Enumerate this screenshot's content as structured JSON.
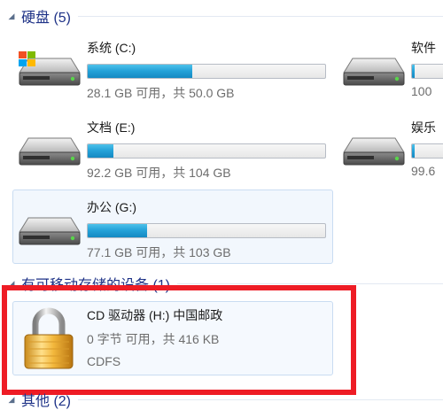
{
  "groups": {
    "hard_disks": {
      "title": "硬盘 (5)"
    },
    "removable": {
      "title": "有可移动存储的设备 (1)"
    },
    "other": {
      "title": "其他 (2)"
    }
  },
  "drives": [
    {
      "name": "系统 (C:)",
      "info": "28.1 GB 可用，共 50.0 GB",
      "used_fraction": 0.44
    },
    {
      "name": "软件",
      "info": "100",
      "used_fraction": 0.05
    },
    {
      "name": "文档 (E:)",
      "info": "92.2 GB 可用，共 104 GB",
      "used_fraction": 0.11
    },
    {
      "name": "娱乐",
      "info": "99.6",
      "used_fraction": 0.05
    },
    {
      "name": "办公 (G:)",
      "info": "77.1 GB 可用，共 103 GB",
      "used_fraction": 0.25
    }
  ],
  "cd_drive": {
    "name": "CD 驱动器 (H:) 中国邮政",
    "info": "0 字节 可用，共 416 KB",
    "filesystem": "CDFS"
  },
  "colors": {
    "group_header": "#1e3287",
    "bar_fill": "#26a3d9",
    "highlight": "#ee1c25"
  }
}
